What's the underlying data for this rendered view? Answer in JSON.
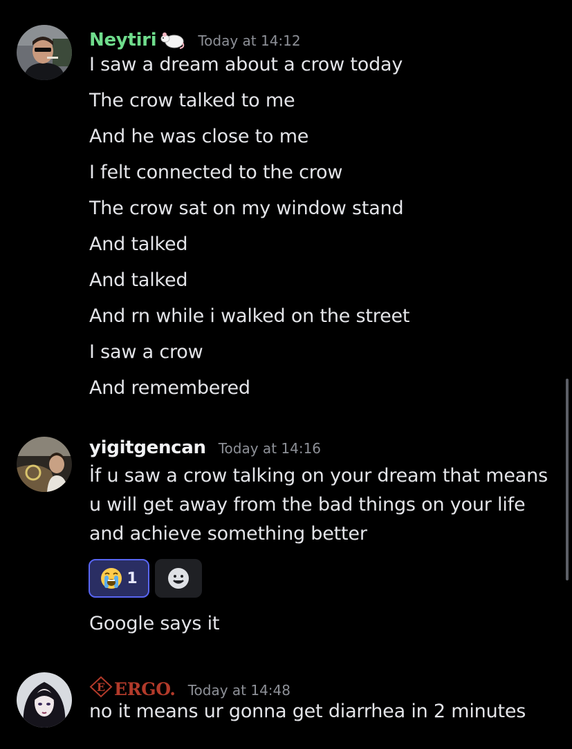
{
  "messages": [
    {
      "author": "Neytiri",
      "author_color": "#6fdc8c",
      "author_icon": "rat-icon",
      "timestamp": "Today at 14:12",
      "lines": [
        "I saw a dream about a crow today",
        "The crow talked to me",
        "And he was close to me",
        "I felt connected to the crow",
        "The crow sat on my window stand",
        "And talked",
        "And talked",
        "And rn while i walked on the street",
        "I saw a crow",
        "And remembered"
      ]
    },
    {
      "author": "yigitgencan",
      "author_color": "#f2f3f5",
      "timestamp": "Today at 14:16",
      "lines": [
        "İf u saw a crow talking on your dream that means",
        "u will get away from the bad things on your life",
        "and achieve something better"
      ],
      "reactions": [
        {
          "emoji": "loudly-crying-face-icon",
          "count": "1",
          "active": true
        },
        {
          "emoji": "add-reaction-icon",
          "count": "",
          "active": false
        }
      ],
      "followup": "Google says it"
    },
    {
      "author": "ERGO.",
      "author_color": "#b23a2a",
      "timestamp": "Today at 14:48",
      "lines": [
        "no it means ur gonna get diarrhea in 2 minutes"
      ]
    }
  ]
}
